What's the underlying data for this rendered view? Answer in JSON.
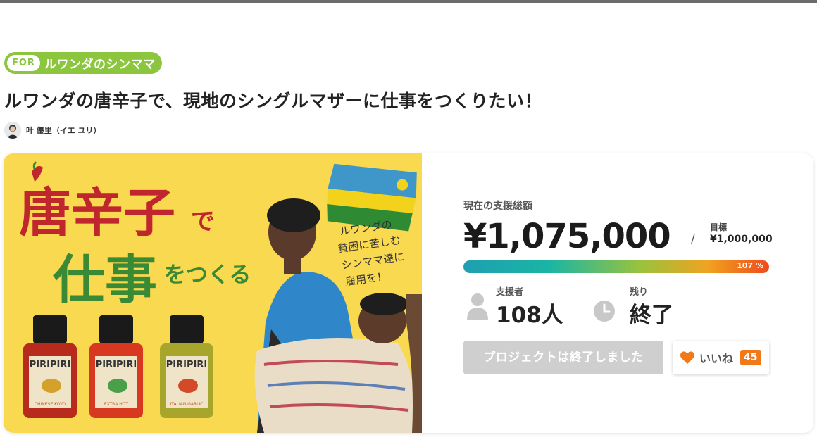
{
  "header": {
    "for_tag": "FOR",
    "for_label": "ルワンダのシンママ",
    "title": "ルワンダの唐辛子で、現地のシングルマザーに仕事をつくりたい！",
    "author_name": "叶 優里（イエ ユリ）"
  },
  "hero": {
    "headline_1": "唐辛子",
    "headline_1_suffix": "で",
    "headline_2": "仕事",
    "headline_2_suffix": "をつくる",
    "handwritten_lines": [
      "ルワンダの",
      "貧困に苦しむ",
      "シンママ達に",
      "雇用を！"
    ],
    "bottle_brand": "PIRIPIRI",
    "bottle_labels": [
      "CHINESE KOYO",
      "EXTRA HOT",
      "ITALIAN GARLIC"
    ]
  },
  "stats": {
    "total_label": "現在の支援総額",
    "total_amount": "¥1,075,000",
    "slash": "/",
    "goal_label": "目標",
    "goal_amount": "¥1,000,000",
    "progress_text": "107 %",
    "progress_percent": 107,
    "backers_label": "支援者",
    "backers_value": "108人",
    "remaining_label": "残り",
    "remaining_value": "終了"
  },
  "actions": {
    "ended_label": "プロジェクトは終了しました",
    "like_label": "いいね",
    "like_count": "45"
  },
  "colors": {
    "for_badge": "#8cc63f",
    "like_accent": "#f07a1a",
    "hero_background": "#f8d94f",
    "headline_red": "#c0262d",
    "headline_green": "#3a8a35"
  }
}
